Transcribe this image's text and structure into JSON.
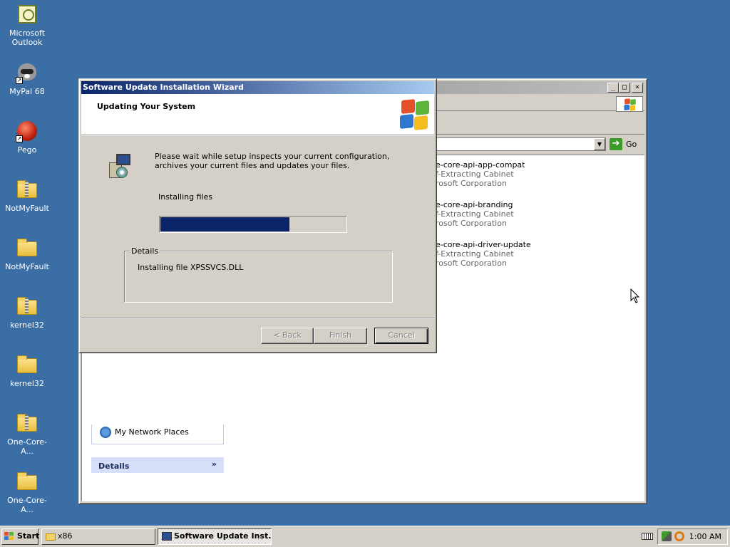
{
  "desktop": {
    "icons": [
      {
        "label": "Microsoft Outlook",
        "icon": "outlook-icon"
      },
      {
        "label": "MyPal 68",
        "icon": "mypal-icon"
      },
      {
        "label": "Pego",
        "icon": "pego-icon"
      },
      {
        "label": "NotMyFault",
        "icon": "zip-folder-icon"
      },
      {
        "label": "NotMyFault",
        "icon": "folder-icon"
      },
      {
        "label": "kernel32",
        "icon": "zip-folder-icon"
      },
      {
        "label": "kernel32",
        "icon": "folder-icon"
      },
      {
        "label": "One-Core-A...",
        "icon": "zip-folder-icon"
      },
      {
        "label": "One-Core-A...",
        "icon": "folder-icon"
      }
    ]
  },
  "explorer": {
    "go_label": "Go",
    "files": [
      {
        "name": "e-core-api-app-compat",
        "type": "f-Extracting Cabinet",
        "company": "rosoft Corporation"
      },
      {
        "name": "e-core-api-branding",
        "type": "f-Extracting Cabinet",
        "company": "rosoft Corporation"
      },
      {
        "name": "e-core-api-driver-update",
        "type": "f-Extracting Cabinet",
        "company": "rosoft Corporation"
      }
    ],
    "other_places_item": "My Network Places",
    "details_label": "Details"
  },
  "wizard": {
    "title": "Software Update Installation Wizard",
    "header_title": "Updating Your System",
    "description": "Please wait while setup inspects your current configuration, archives your current files and updates your files.",
    "status": "Installing files",
    "progress": 0.7,
    "details_legend": "Details",
    "details_text": "Installing file XPSSVCS.DLL",
    "buttons": {
      "back": "< Back",
      "finish": "Finish",
      "cancel": "Cancel"
    }
  },
  "taskbar": {
    "start_label": "Start",
    "tasks": [
      {
        "label": "x86",
        "active": false
      },
      {
        "label": "Software Update Inst...",
        "active": true
      }
    ],
    "clock": "1:00 AM"
  },
  "colors": {
    "desktop": "#3a6ea5",
    "active_title": "#0a246a",
    "inactive_title": "#808080",
    "face": "#d4d0c8"
  }
}
